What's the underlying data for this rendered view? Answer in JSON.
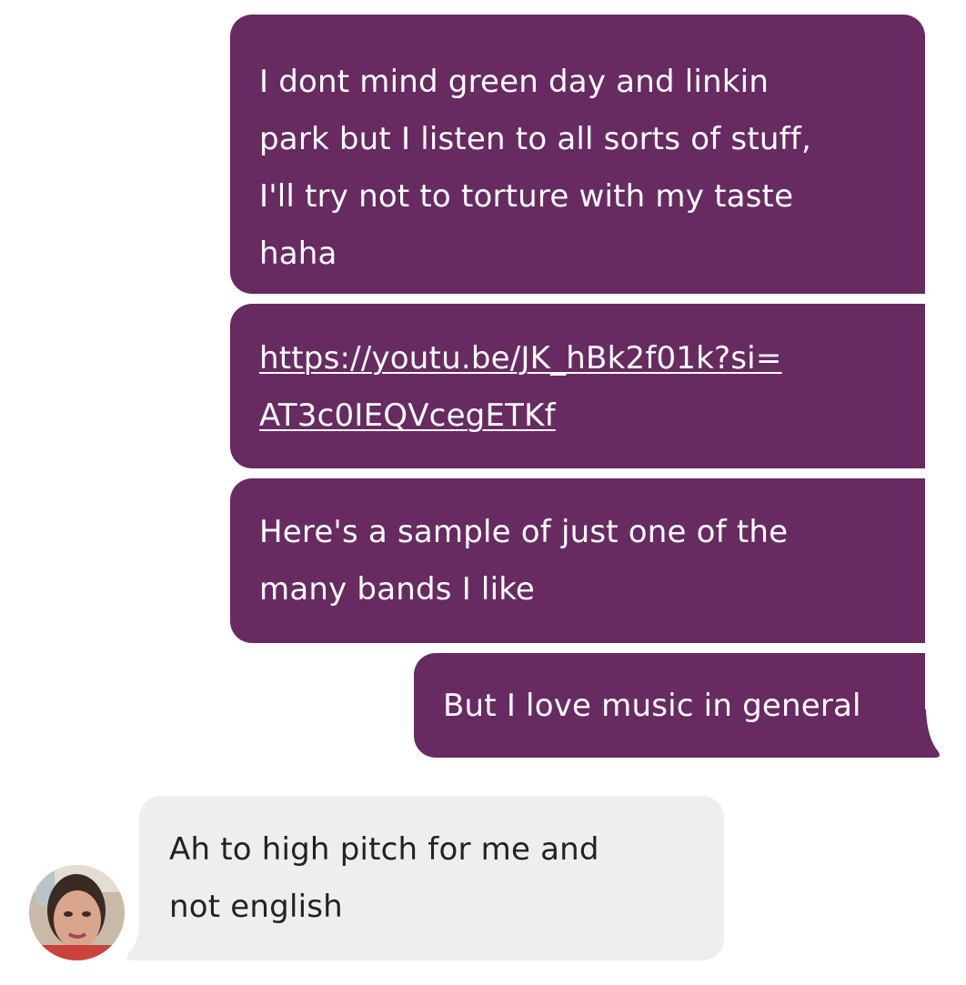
{
  "colors": {
    "outgoing_bubble": "#672a61",
    "outgoing_text": "#ffffff",
    "incoming_bubble": "#eeeeef",
    "incoming_text": "#222222",
    "background": "#ffffff"
  },
  "messages": [
    {
      "direction": "outgoing",
      "lines": [
        "I dont mind green day and linkin",
        "park but I listen to all sorts of stuff,",
        "I'll try not to torture with my taste",
        "haha"
      ]
    },
    {
      "direction": "outgoing",
      "type": "link",
      "lines": [
        "https://youtu.be/JK_hBk2f01k?si=",
        "AT3c0IEQVcegETKf"
      ]
    },
    {
      "direction": "outgoing",
      "lines": [
        "Here's a sample of just one of the",
        "many bands I like"
      ]
    },
    {
      "direction": "outgoing",
      "lines": [
        "But I love music in general"
      ]
    },
    {
      "direction": "incoming",
      "avatar": "user-avatar",
      "lines": [
        "Ah to high pitch for me and",
        "not english"
      ]
    }
  ]
}
